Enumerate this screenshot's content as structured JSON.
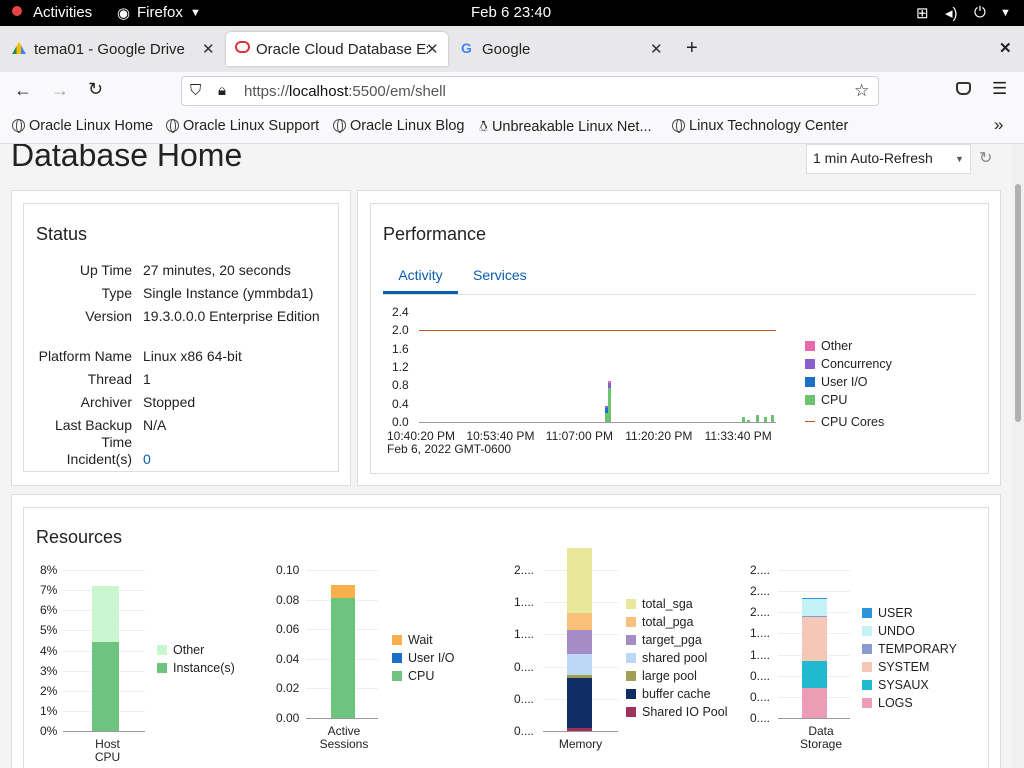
{
  "topbar": {
    "activities": "Activities",
    "app": "Firefox",
    "clock": "Feb 6  23:40"
  },
  "tabs": [
    {
      "title": "tema01 - Google Drive"
    },
    {
      "title": "Oracle Cloud Database Exp"
    },
    {
      "title": "Google"
    }
  ],
  "url": {
    "prefix": "https://",
    "host": "localhost",
    "rest": ":5500/em/shell"
  },
  "bookmarks": [
    "Oracle Linux Home",
    "Oracle Linux Support",
    "Oracle Linux Blog",
    "Unbreakable Linux Net...",
    "Linux Technology Center"
  ],
  "page": {
    "title": "Database Home",
    "refresh": "1 min Auto-Refresh"
  },
  "status": {
    "heading": "Status",
    "rows": [
      {
        "label": "Up Time",
        "value": "27 minutes, 20 seconds"
      },
      {
        "label": "Type",
        "value": "Single Instance (ymmbda1)"
      },
      {
        "label": "Version",
        "value": "19.3.0.0.0 Enterprise Edition"
      },
      {
        "label": "Platform Name",
        "value": "Linux x86 64-bit"
      },
      {
        "label": "Thread",
        "value": "1"
      },
      {
        "label": "Archiver",
        "value": "Stopped"
      },
      {
        "label": "Last Backup Time",
        "value": "N/A"
      },
      {
        "label": "Incident(s)",
        "value": "0"
      }
    ]
  },
  "performance": {
    "heading": "Performance",
    "tabs": [
      "Activity",
      "Services"
    ]
  },
  "chart_data": [
    {
      "type": "bar",
      "title": "Performance Activity",
      "yticks": [
        "2.4",
        "2.0",
        "1.6",
        "1.2",
        "0.8",
        "0.4",
        "0.0"
      ],
      "ylim": [
        0,
        2.4
      ],
      "xticks": [
        "10:40:20 PM",
        "10:53:40 PM",
        "11:07:00 PM",
        "11:20:20 PM",
        "11:33:40 PM"
      ],
      "xsub": "Feb 6, 2022 GMT-0600",
      "series": [
        {
          "name": "Other",
          "color": "#e86bb0"
        },
        {
          "name": "Concurrency",
          "color": "#8a5fcf"
        },
        {
          "name": "User I/O",
          "color": "#1a6fc7"
        },
        {
          "name": "CPU",
          "color": "#6cc46f"
        }
      ],
      "line": {
        "name": "CPU Cores",
        "value": 2.0,
        "color": "#c0532a"
      },
      "spikes": [
        {
          "t": 0.52,
          "cpu": 0.2,
          "userio": 0.1,
          "concurrency": 0.05
        },
        {
          "t": 0.53,
          "cpu": 0.75,
          "userio": 0.0,
          "concurrency": 0.1,
          "other": 0.05
        },
        {
          "t": 0.905,
          "cpu": 0.1
        },
        {
          "t": 0.92,
          "cpu": 0.05
        },
        {
          "t": 0.945,
          "cpu": 0.15
        },
        {
          "t": 0.965,
          "cpu": 0.12
        },
        {
          "t": 0.985,
          "cpu": 0.15
        }
      ]
    },
    {
      "type": "bar",
      "title": "Host CPU",
      "xlabel": "Host CPU",
      "yticks": [
        "8%",
        "7%",
        "6%",
        "5%",
        "4%",
        "3%",
        "2%",
        "1%",
        "0%"
      ],
      "ylim": [
        0,
        8
      ],
      "stack": [
        {
          "name": "Instance(s)",
          "value": 4.4,
          "color": "#6cc47e"
        },
        {
          "name": "Other",
          "value": 2.8,
          "color": "#c9f5cf"
        }
      ]
    },
    {
      "type": "bar",
      "title": "Active Sessions",
      "xlabel": "Active Sessions",
      "yticks": [
        "0.10",
        "0.08",
        "0.06",
        "0.04",
        "0.02",
        "0.00"
      ],
      "ylim": [
        0,
        0.1
      ],
      "stack": [
        {
          "name": "CPU",
          "value": 0.081,
          "color": "#6cc47e"
        },
        {
          "name": "User I/O",
          "value": 0,
          "color": "#1a6fc7"
        },
        {
          "name": "Wait",
          "value": 0.009,
          "color": "#f7b04c"
        }
      ]
    },
    {
      "type": "bar",
      "title": "Memory",
      "xlabel": "Memory",
      "yticks": [
        "2....",
        "1....",
        "1....",
        "0....",
        "0....",
        "0...."
      ],
      "ylim": [
        0,
        2
      ],
      "stack": [
        {
          "name": "Shared IO Pool",
          "value": 0.04,
          "color": "#a0315e"
        },
        {
          "name": "buffer cache",
          "value": 0.62,
          "color": "#0f2f64"
        },
        {
          "name": "large pool",
          "value": 0.04,
          "color": "#9fa050"
        },
        {
          "name": "shared pool",
          "value": 0.26,
          "color": "#bdd8f7"
        },
        {
          "name": "target_pga",
          "value": 0.29,
          "color": "#a68cc6"
        },
        {
          "name": "total_pga",
          "value": 0.21,
          "color": "#f9c07a"
        },
        {
          "name": "total_sga",
          "value": 0.81,
          "color": "#e8e89a"
        }
      ]
    },
    {
      "type": "bar",
      "title": "Data Storage",
      "xlabel": "Data Storage",
      "yticks": [
        "2....",
        "2....",
        "2....",
        "1....",
        "1....",
        "0....",
        "0....",
        "0...."
      ],
      "ylim": [
        0,
        3
      ],
      "stack": [
        {
          "name": "LOGS",
          "value": 0.6,
          "color": "#ec9cb4"
        },
        {
          "name": "SYSAUX",
          "value": 0.55,
          "color": "#21b9cf"
        },
        {
          "name": "SYSTEM",
          "value": 0.9,
          "color": "#f5c7b6"
        },
        {
          "name": "TEMPORARY",
          "value": 0.02,
          "color": "#8a9ad1"
        },
        {
          "name": "UNDO",
          "value": 0.35,
          "color": "#c6f1f5"
        },
        {
          "name": "USER",
          "value": 0.02,
          "color": "#2a96d9"
        }
      ]
    }
  ],
  "resources": {
    "heading": "Resources",
    "legends": {
      "hostcpu": [
        "Other",
        "Instance(s)"
      ],
      "sessions": [
        "Wait",
        "User I/O",
        "CPU"
      ],
      "memory": [
        "total_sga",
        "total_pga",
        "target_pga",
        "shared pool",
        "large pool",
        "buffer cache",
        "Shared IO Pool"
      ],
      "storage": [
        "USER",
        "UNDO",
        "TEMPORARY",
        "SYSTEM",
        "SYSAUX",
        "LOGS"
      ]
    }
  },
  "colors": {
    "link": "#0b5cad",
    "accent": "#0b5cad"
  }
}
